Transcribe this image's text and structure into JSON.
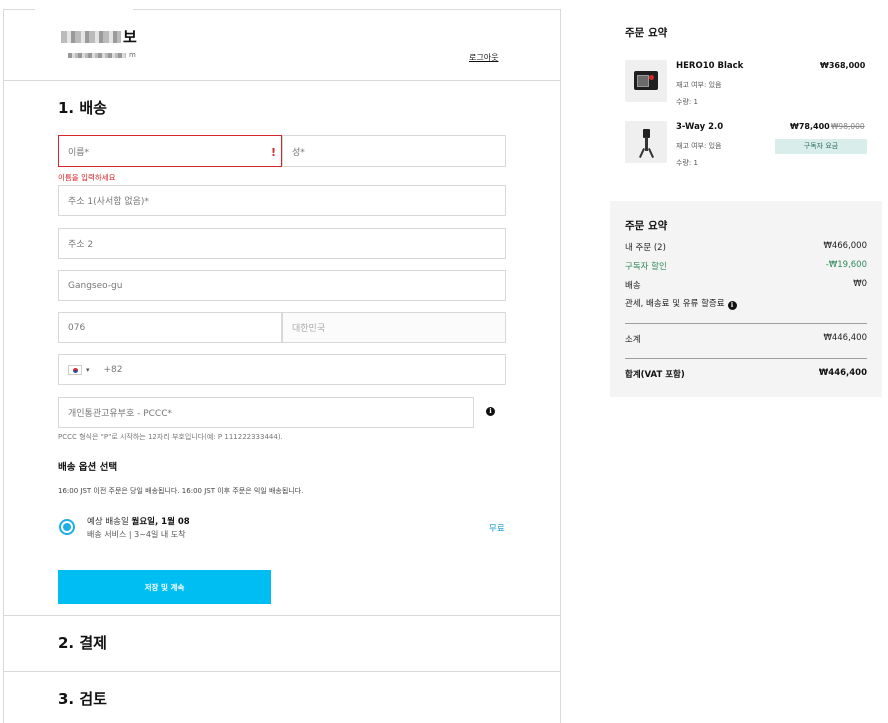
{
  "account": {
    "name_suffix": "보",
    "email_suffix": "m",
    "logout_label": "로그아웃"
  },
  "shipping": {
    "section_title": "1. 배송",
    "first_name_placeholder": "이름*",
    "first_name_error": "이름을 입력하세요",
    "last_name_placeholder": "성*",
    "address1_placeholder": "주소 1(사서함 없음)*",
    "address2_placeholder": "주소 2",
    "city_value": "Gangseo-gu",
    "postal_value": "076",
    "country_value": "대한민국",
    "phone_code": "+82",
    "pccc_placeholder": "개인통관고유부호 - PCCC*",
    "pccc_hint": "PCCC 형식은 \"P\"로 시작하는 12자리 부호입니다(예: P 111222333444).",
    "options_title": "배송 옵션 선택",
    "options_note": "16:00 JST 이전 주문은 당일 배송됩니다. 16:00 JST 이후 주문은 익일 배송됩니다.",
    "option": {
      "eta_prefix": "예상 배송일 ",
      "eta_date": "월요일, 1월 08",
      "service": "배송 서비스 | 3~4일 내 도착",
      "price": "무료"
    },
    "save_button": "저장 및 계속"
  },
  "steps": {
    "payment": "2. 결제",
    "review": "3. 검토"
  },
  "order_summary": {
    "title": "주문 요약",
    "items": [
      {
        "name": "HERO10 Black",
        "stock": "재고 여부: 있음",
        "qty": "수량: 1",
        "price": "₩368,000"
      },
      {
        "name": "3-Way 2.0",
        "stock": "재고 여부: 있음",
        "qty": "수량: 1",
        "price": "₩78,400",
        "old_price": "₩98,000",
        "badge": "구독자 요금"
      }
    ]
  },
  "totals": {
    "title": "주문 요약",
    "my_order_label": "내 주문 (2)",
    "my_order_value": "₩466,000",
    "discount_label": "구독자 할인",
    "discount_value": "-₩19,600",
    "shipping_label": "배송",
    "shipping_value": "₩0",
    "duties_label": "관세, 배송료 및 유류 할증료",
    "subtotal_label": "소계",
    "subtotal_value": "₩446,400",
    "total_label": "합계(VAT 포함)",
    "total_value": "₩446,400"
  },
  "colors": {
    "accent": "#00bdf2",
    "error": "#d7262b",
    "discount": "#2f8a5a"
  }
}
